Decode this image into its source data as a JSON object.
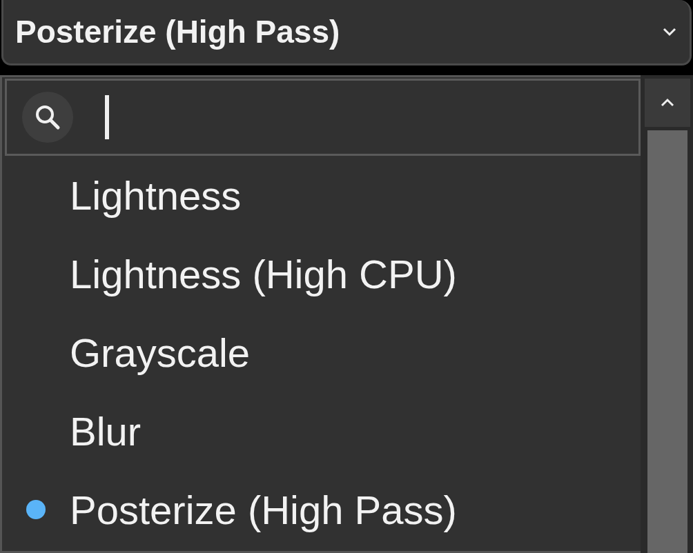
{
  "dropdown": {
    "value": "Posterize (High Pass)"
  },
  "search": {
    "focused": true
  },
  "items": [
    {
      "label": "Lightness",
      "selected": false
    },
    {
      "label": "Lightness (High CPU)",
      "selected": false
    },
    {
      "label": "Grayscale",
      "selected": false
    },
    {
      "label": "Blur",
      "selected": false
    },
    {
      "label": "Posterize (High Pass)",
      "selected": true
    }
  ]
}
